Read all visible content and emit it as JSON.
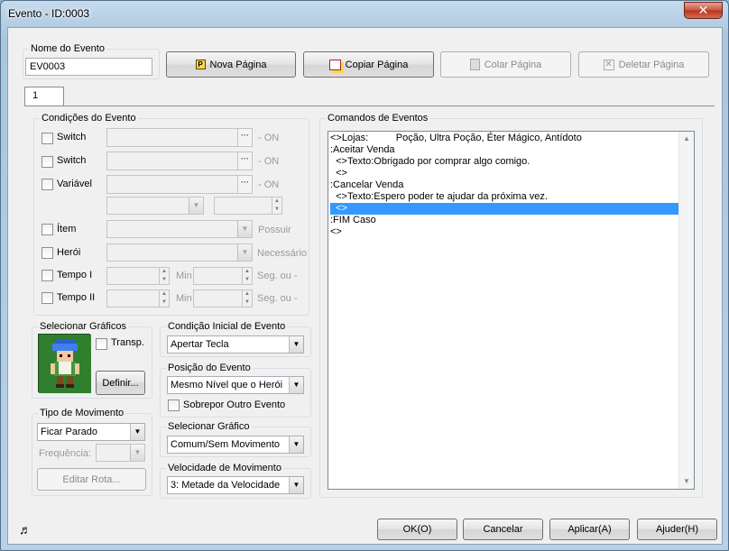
{
  "window": {
    "title": "Evento - ID:0003",
    "close_label": "✕"
  },
  "event_name": {
    "legend": "Nome do Evento",
    "value": "EV0003"
  },
  "page_buttons": {
    "new": "Nova Página",
    "copy": "Copiar Página",
    "paste": "Colar Página",
    "delete": "Deletar Página"
  },
  "tabs": [
    "1"
  ],
  "conditions": {
    "legend": "Condições do Evento",
    "switch1": {
      "label": "Switch",
      "suffix": "- ON"
    },
    "switch2": {
      "label": "Switch",
      "suffix": "- ON"
    },
    "variable": {
      "label": "Variável",
      "suffix": "- ON"
    },
    "item": {
      "label": "Ítem",
      "suffix": "Possuir"
    },
    "hero": {
      "label": "Herói",
      "suffix": "Necessário"
    },
    "timer1": {
      "label": "Tempo I",
      "min": "Min",
      "suffix": "Seg. ou -"
    },
    "timer2": {
      "label": "Tempo II",
      "min": "Min",
      "suffix": "Seg. ou -"
    }
  },
  "graphics": {
    "legend": "Selecionar Gráficos",
    "transp": "Transp.",
    "define": "Definir..."
  },
  "initial_condition": {
    "legend": "Condição Inicial de Evento",
    "value": "Apertar Tecla"
  },
  "event_position": {
    "legend": "Posição do Evento",
    "value": "Mesmo Nível que o Herói",
    "overlap": "Sobrepor Outro Evento"
  },
  "select_graphic": {
    "legend": "Selecionar Gráfico",
    "value": "Comum/Sem Movimento"
  },
  "move_speed": {
    "legend": "Velocidade de Movimento",
    "value": "3: Metade da Velocidade"
  },
  "move_type": {
    "legend": "Tipo de Movimento",
    "value": "Ficar Parado",
    "frequency": "Frequência:",
    "edit_route": "Editar Rota..."
  },
  "commands": {
    "legend": "Comandos de Eventos",
    "lines": [
      "<>Lojas:          Poção, Ultra Poção, Éter Mágico, Antídoto",
      ":Aceitar Venda",
      "  <>Texto:Obrigado por comprar algo comigo.",
      "  <>",
      ":Cancelar Venda",
      "  <>Texto:Espero poder te ajudar da próxima vez.",
      "  <>",
      ":FIM Caso",
      "<>"
    ],
    "selected_index": 6
  },
  "footer": {
    "ok": "OK(O)",
    "cancel": "Cancelar",
    "apply": "Aplicar(A)",
    "help": "Ajuder(H)"
  },
  "colors": {
    "selection": "#3399ff",
    "sprite_bg": "#2f7f2f"
  }
}
